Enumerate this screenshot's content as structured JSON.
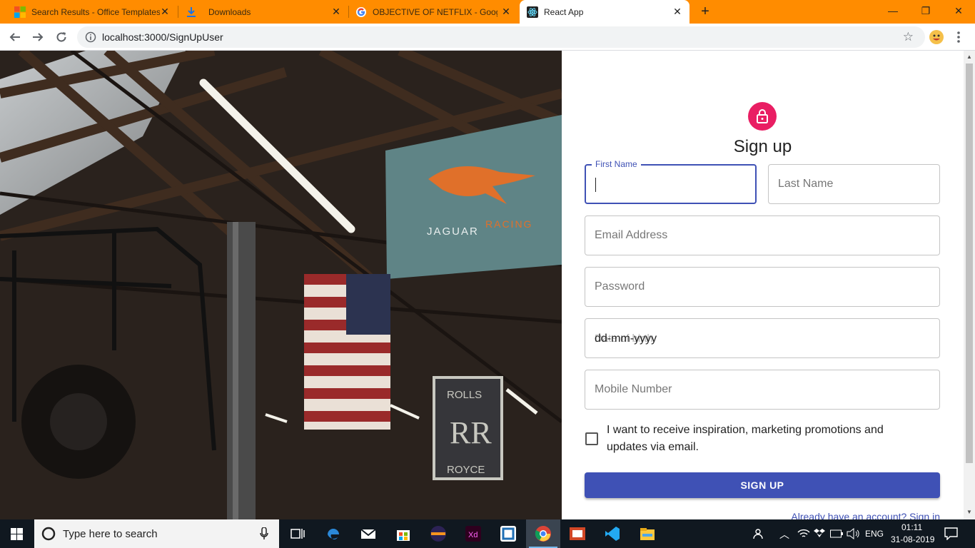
{
  "browser": {
    "tabs": [
      {
        "label": "Search Results - Office Templates",
        "icon": "microsoft-icon"
      },
      {
        "label": "Downloads",
        "icon": "download-icon"
      },
      {
        "label": "OBJECTIVE OF NETFLIX - Google",
        "icon": "google-icon"
      },
      {
        "label": "React App",
        "icon": "react-icon",
        "active": true
      }
    ],
    "new_tab": "+",
    "url": "localhost:3000/SignUpUser",
    "window_controls": {
      "minimize": "—",
      "maximize": "❐",
      "close": "✕"
    },
    "accent_color": "#ff8c00"
  },
  "hero": {
    "banner_text": "JAGUAR",
    "banner_text2": "RACING",
    "sign_text1": "ROLLS",
    "sign_text2": "RR",
    "sign_text3": "ROYCE"
  },
  "form": {
    "heading": "Sign up",
    "first_name_label": "First Name",
    "last_name_placeholder": "Last Name",
    "email_placeholder": "Email Address",
    "password_placeholder": "Password",
    "dob_placeholder": "Date of birth",
    "dob_format": "dd-mm-yyyy",
    "mobile_placeholder": "Mobile Number",
    "consent_text": "I want to receive inspiration, marketing promotions and updates via email.",
    "consent_checked": false,
    "submit_label": "SIGN UP",
    "signin_link": "Already have an account? Sign in",
    "primary_color": "#3f51b5",
    "avatar_color": "#e91e63"
  },
  "taskbar": {
    "search_placeholder": "Type here to search",
    "language": "ENG",
    "time": "01:11",
    "date": "31-08-2019"
  }
}
